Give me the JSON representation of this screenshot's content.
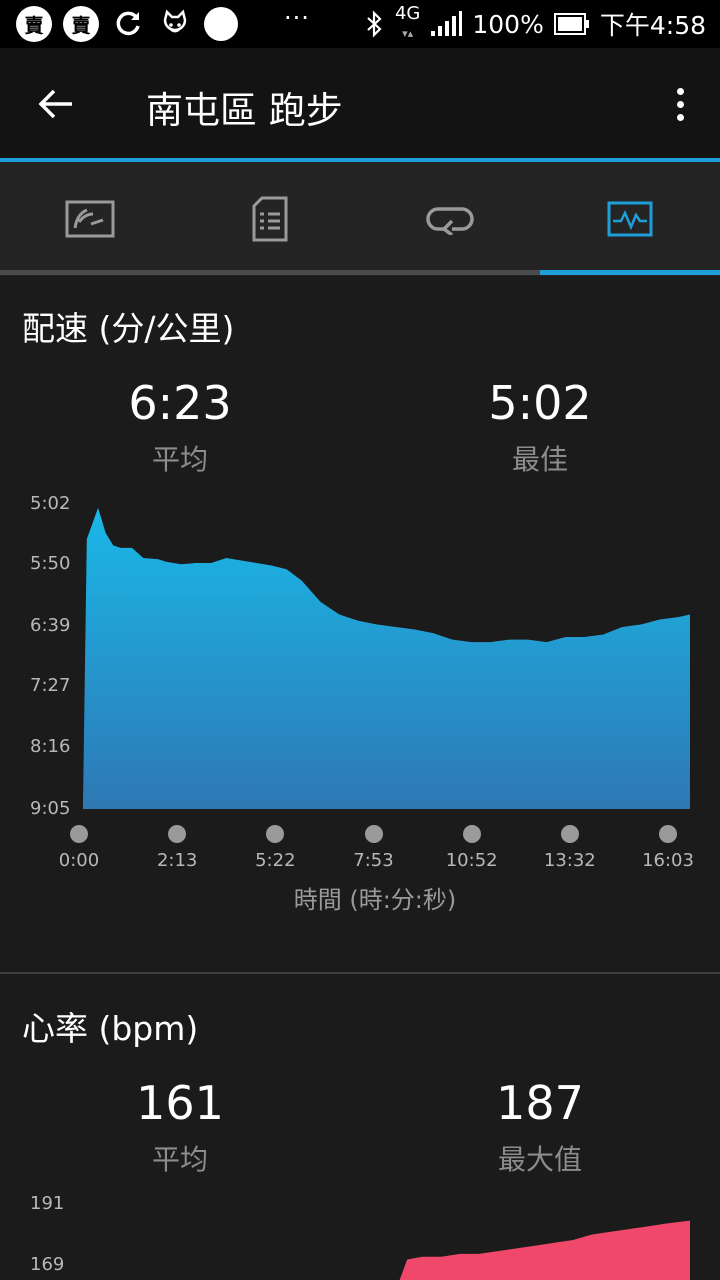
{
  "status_bar": {
    "badge_1": "賣",
    "badge_2": "賣",
    "more": "···",
    "network": "4G",
    "battery": "100%",
    "time": "下午4:58"
  },
  "app_bar": {
    "title": "南屯區 跑步"
  },
  "tabs": [
    {
      "icon": "gauge-icon"
    },
    {
      "icon": "list-document-icon"
    },
    {
      "icon": "loop-icon"
    },
    {
      "icon": "chart-pulse-icon",
      "active": true
    }
  ],
  "pace": {
    "title": "配速 (分/公里)",
    "avg_value": "6:23",
    "avg_label": "平均",
    "best_value": "5:02",
    "best_label": "最佳",
    "x_axis_title": "時間 (時:分:秒)",
    "color": "#1fb0e0"
  },
  "heart_rate": {
    "title": "心率 (bpm)",
    "avg_value": "161",
    "avg_label": "平均",
    "max_value": "187",
    "max_label": "最大值",
    "color": "#f0486a"
  },
  "chart_data": [
    {
      "type": "area",
      "xlabel": "時間 (時:分:秒)",
      "ylabel": "配速 (分/公里)",
      "y_inverted": true,
      "y_ticks": [
        "5:02",
        "5:50",
        "6:39",
        "7:27",
        "8:16",
        "9:05"
      ],
      "x_ticks": [
        "0:00",
        "2:13",
        "5:22",
        "7:53",
        "10:52",
        "13:32",
        "16:03"
      ],
      "x": [
        0,
        0.1,
        0.4,
        0.6,
        0.8,
        1.0,
        1.3,
        1.6,
        2.0,
        2.2,
        2.6,
        3.0,
        3.4,
        3.8,
        4.2,
        4.6,
        5.0,
        5.4,
        5.8,
        6.3,
        6.8,
        7.3,
        7.8,
        8.3,
        8.8,
        9.3,
        9.8,
        10.3,
        10.8,
        11.3,
        11.8,
        12.3,
        12.8,
        13.3,
        13.8,
        14.3,
        14.8,
        15.3,
        15.8,
        16.1
      ],
      "y": [
        540,
        330,
        305,
        325,
        335,
        337,
        337,
        345,
        346,
        348,
        350,
        349,
        349,
        345,
        347,
        349,
        351,
        354,
        363,
        380,
        390,
        395,
        398,
        400,
        402,
        405,
        410,
        412,
        412,
        410,
        410,
        412,
        408,
        408,
        406,
        400,
        398,
        394,
        392,
        390
      ]
    },
    {
      "type": "area",
      "ylabel": "心率 (bpm)",
      "y_ticks": [
        "191",
        "169"
      ],
      "x": [
        8.3,
        8.6,
        9.0,
        9.5,
        10.0,
        10.5,
        11.0,
        11.5,
        12.0,
        12.5,
        13.0,
        13.5,
        14.0,
        14.5,
        15.0,
        15.5,
        16.1
      ],
      "y": [
        160,
        171,
        172,
        172,
        173,
        173,
        174,
        175,
        176,
        177,
        178,
        180,
        181,
        182,
        183,
        184,
        185
      ]
    }
  ]
}
